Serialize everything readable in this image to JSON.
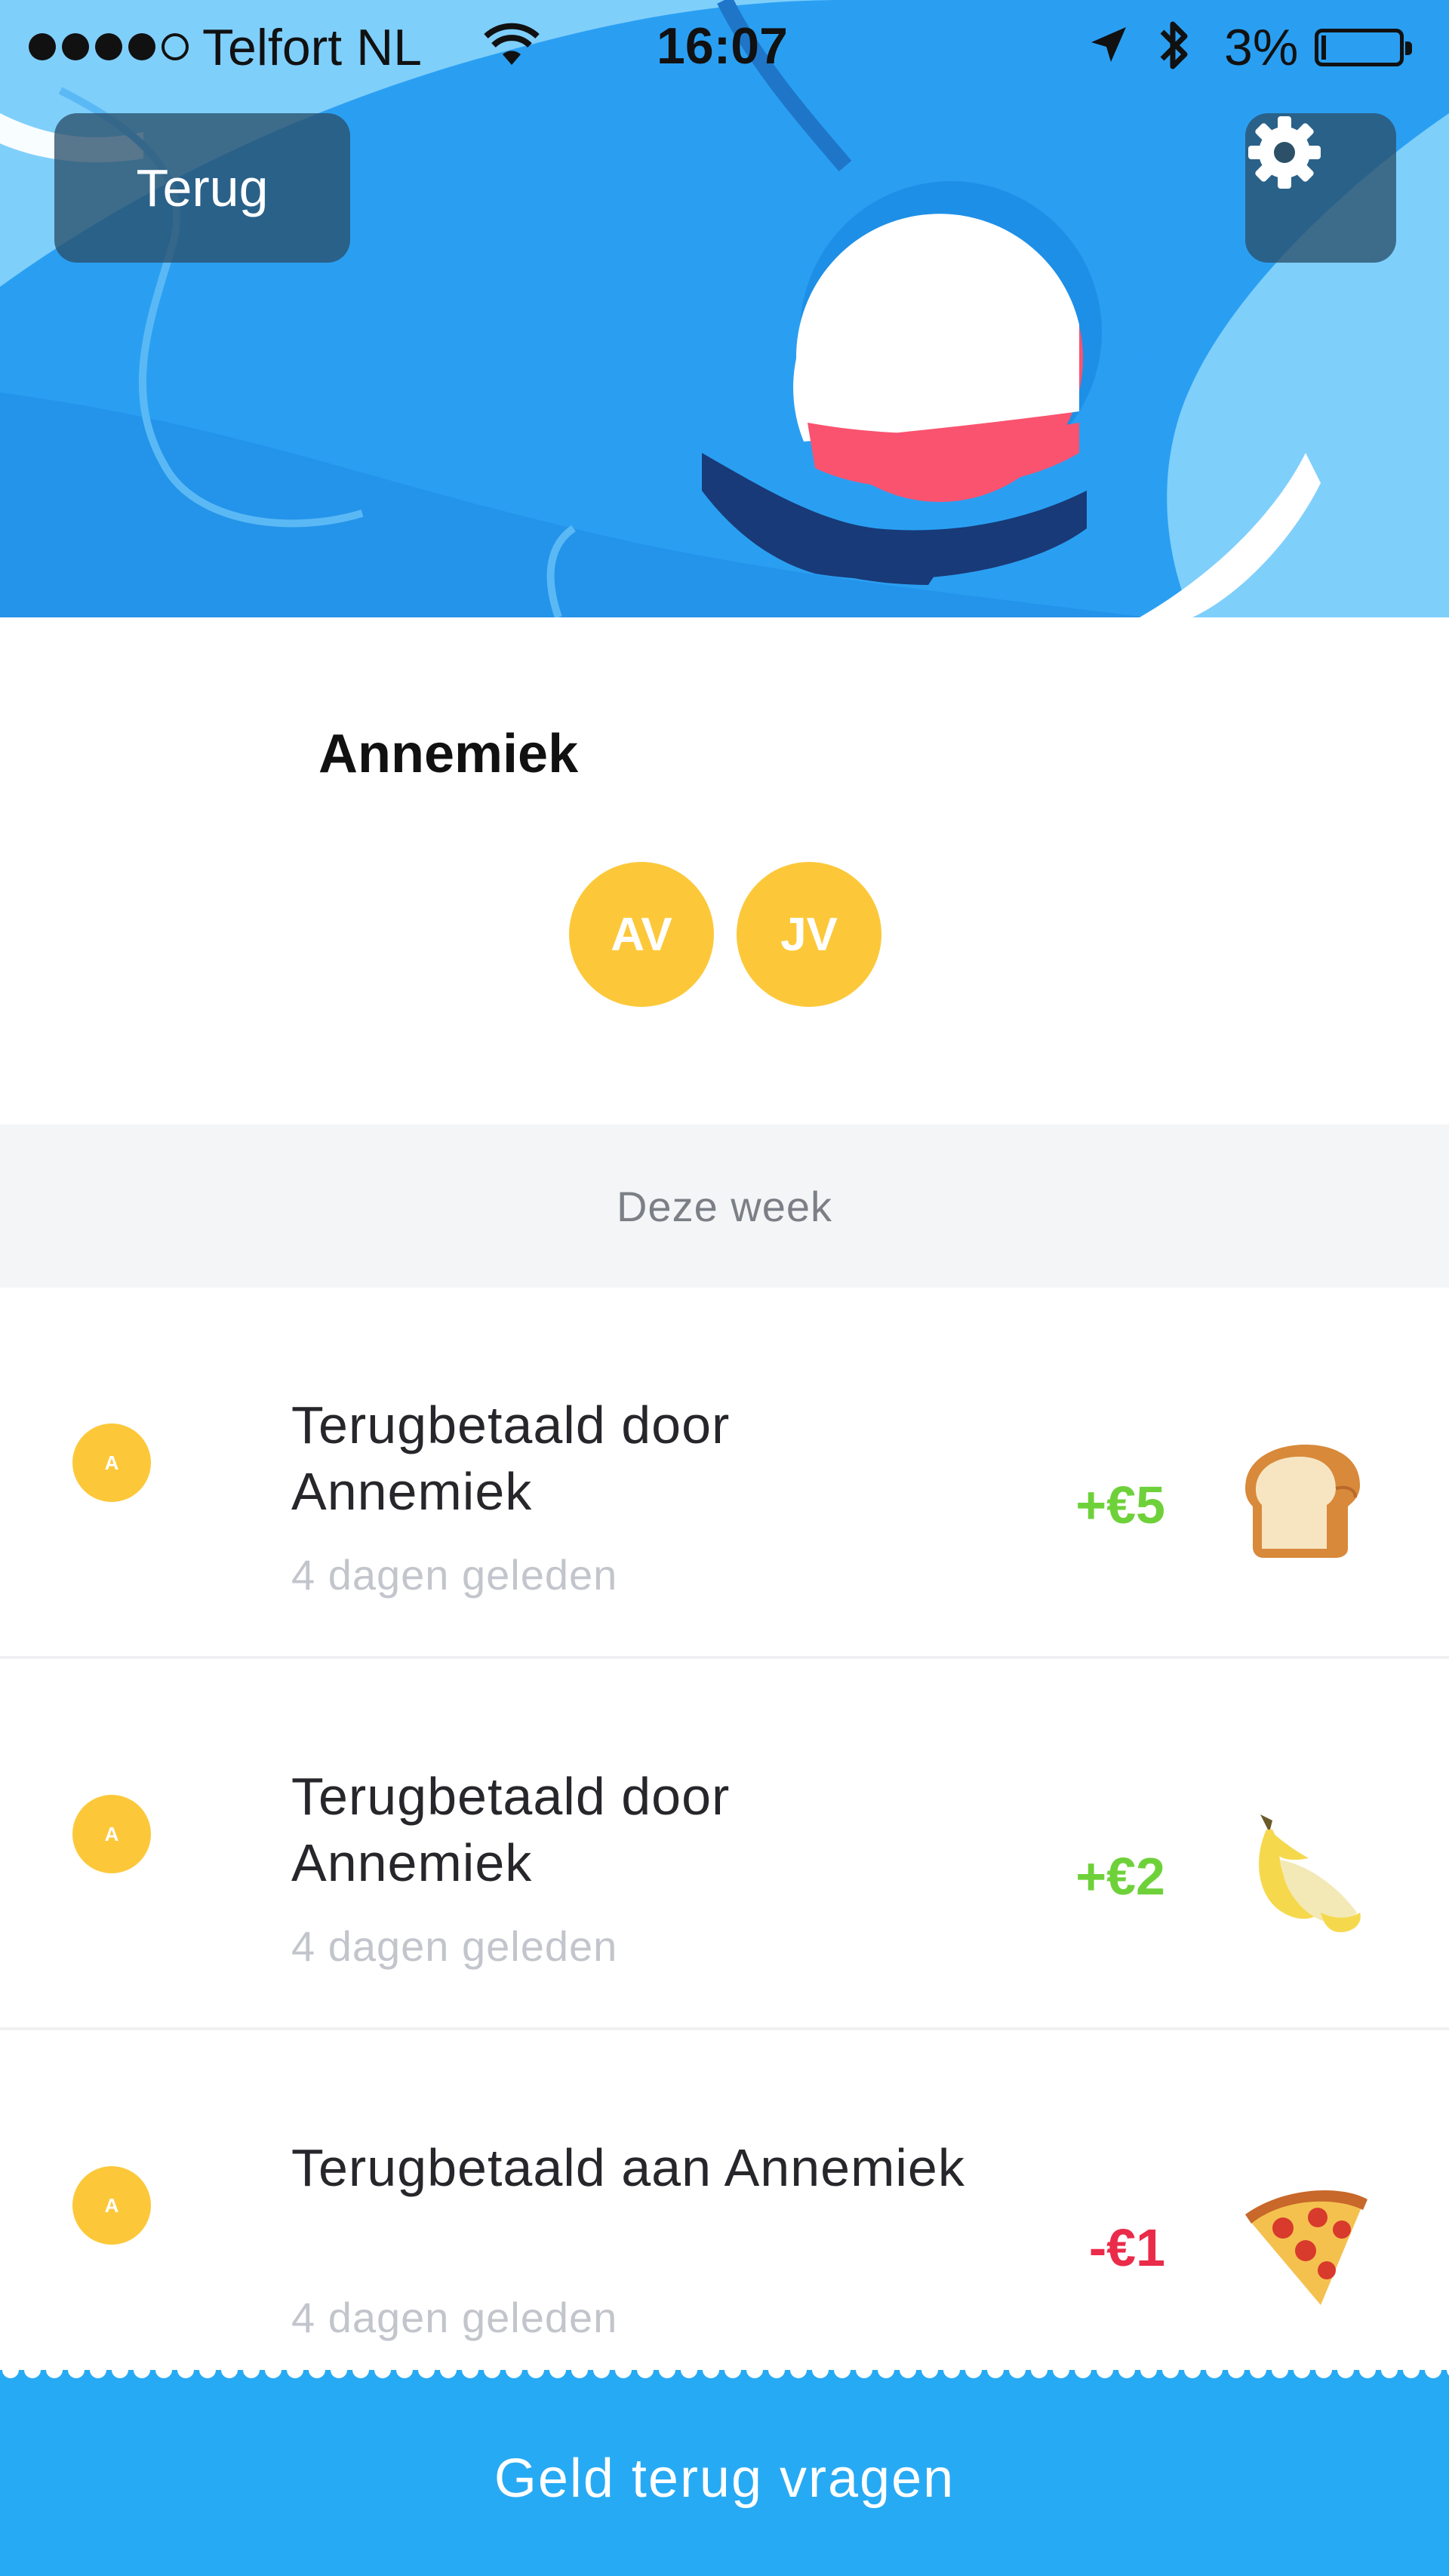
{
  "status_bar": {
    "carrier": "Telfort NL",
    "time": "16:07",
    "battery": "3%",
    "icons": [
      "signal-dots",
      "wifi-icon",
      "location-arrow-icon",
      "bluetooth-icon",
      "battery-icon"
    ]
  },
  "header": {
    "back_label": "Terug",
    "settings_icon": "gear-icon"
  },
  "profile": {
    "name": "Annemiek",
    "avatars": [
      "AV",
      "JV"
    ]
  },
  "section": {
    "title": "Deze week"
  },
  "transactions": [
    {
      "avatar": "A",
      "title": "Terugbetaald door Annemiek",
      "time": "4 dagen geleden",
      "amount": "+€5",
      "direction": "positive",
      "emoji": "bread-emoji"
    },
    {
      "avatar": "A",
      "title": "Terugbetaald door Annemiek",
      "time": "4 dagen geleden",
      "amount": "+€2",
      "direction": "positive",
      "emoji": "banana-emoji"
    },
    {
      "avatar": "A",
      "title": "Terugbetaald aan Annemiek",
      "time": "4 dagen geleden",
      "amount": "-€1",
      "direction": "negative",
      "emoji": "pizza-emoji"
    }
  ],
  "action": {
    "label": "Geld terug vragen"
  },
  "colors": {
    "accent_blue": "#27aaf4",
    "avatar_yellow": "#fcc83a",
    "positive_green": "#6ed13a",
    "negative_red": "#ea2b4a",
    "section_bg": "#f4f5f7"
  }
}
